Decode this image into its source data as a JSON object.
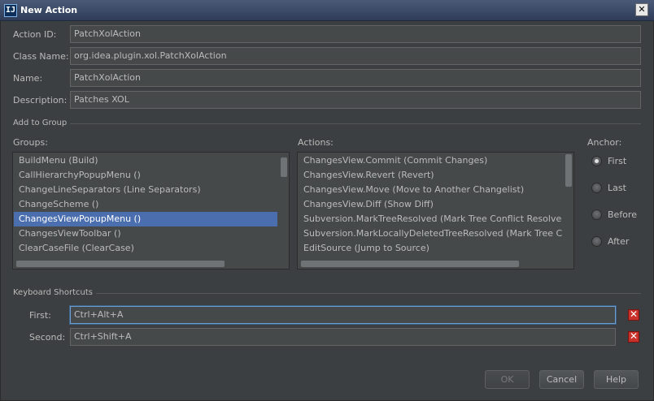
{
  "window": {
    "title": "New Action",
    "icon_text": "IJ",
    "close_glyph": "✕"
  },
  "form": {
    "action_id_label": "Action ID:",
    "action_id_value": "PatchXolAction",
    "class_name_label": "Class Name:",
    "class_name_value": "org.idea.plugin.xol.PatchXolAction",
    "name_label": "Name:",
    "name_value": "PatchXolAction",
    "description_label": "Description:",
    "description_value": "Patches XOL"
  },
  "add_to_group": {
    "title": "Add to Group",
    "groups_label": "Groups:",
    "groups": [
      "BuildMenu (Build)",
      "CallHierarchyPopupMenu ()",
      "ChangeLineSeparators (Line Separators)",
      "ChangeScheme ()",
      "ChangesViewPopupMenu ()",
      "ChangesViewToolbar ()",
      "ClearCaseFile (ClearCase)"
    ],
    "selected_group": "ChangesViewPopupMenu ()",
    "actions_label": "Actions:",
    "actions": [
      "ChangesView.Commit (Commit Changes)",
      "ChangesView.Revert (Revert)",
      "ChangesView.Move (Move to Another Changelist)",
      "ChangesView.Diff (Show Diff)",
      "Subversion.MarkTreeResolved (Mark Tree Conflict Resolved...)",
      "Subversion.MarkLocallyDeletedTreeResolved (Mark Tree Conflict R",
      "EditSource (Jump to Source)"
    ],
    "anchor_label": "Anchor:",
    "anchor_options": [
      "First",
      "Last",
      "Before",
      "After"
    ],
    "anchor_selected": "First"
  },
  "shortcuts": {
    "title": "Keyboard Shortcuts",
    "first_label": "First:",
    "first_value": "Ctrl+Alt+A",
    "second_label": "Second:",
    "second_value": "Ctrl+Shift+A",
    "delete_glyph": "✕"
  },
  "buttons": {
    "ok": "OK",
    "cancel": "Cancel",
    "help": "Help"
  },
  "colors": {
    "background": "#3c3f41",
    "selection": "#4b6eaf",
    "delete": "#c8322a"
  }
}
